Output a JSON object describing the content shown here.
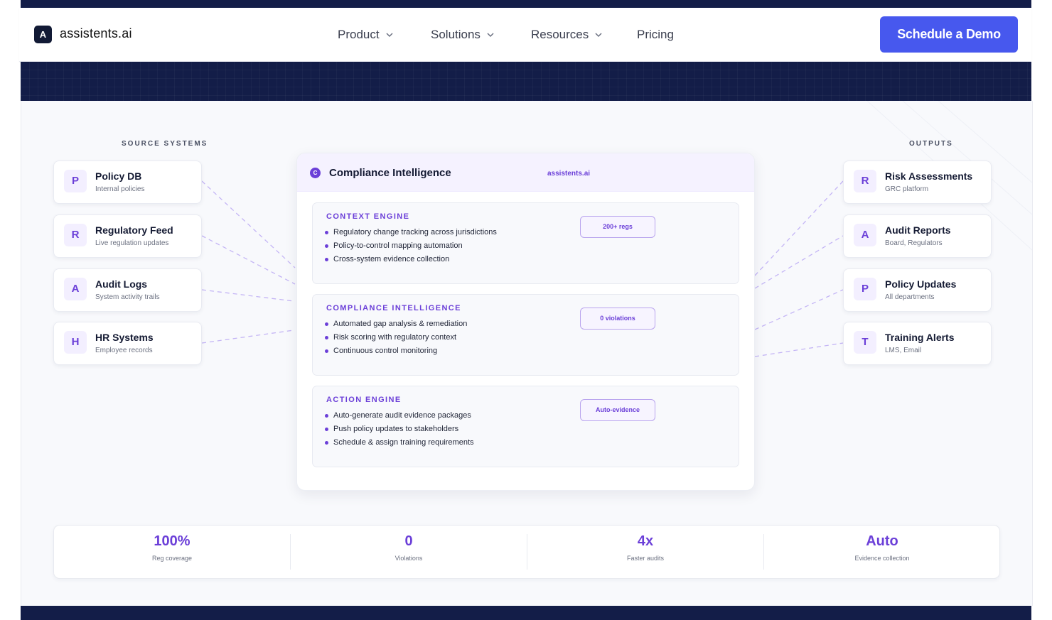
{
  "navbar": {
    "logo_letter": "A",
    "brand": "assistents.ai",
    "items": [
      {
        "label": "Product",
        "has_dropdown": true
      },
      {
        "label": "Solutions",
        "has_dropdown": true
      },
      {
        "label": "Resources",
        "has_dropdown": true
      },
      {
        "label": "Pricing",
        "has_dropdown": false
      }
    ],
    "cta_label": "Schedule a Demo"
  },
  "sources": {
    "title": "SOURCE SYSTEMS",
    "items": [
      {
        "letter": "P",
        "title": "Policy DB",
        "subtitle": "Internal policies"
      },
      {
        "letter": "R",
        "title": "Regulatory Feed",
        "subtitle": "Live regulation updates"
      },
      {
        "letter": "A",
        "title": "Audit Logs",
        "subtitle": "System activity trails"
      },
      {
        "letter": "H",
        "title": "HR Systems",
        "subtitle": "Employee records"
      }
    ]
  },
  "outputs": {
    "title": "OUTPUTS",
    "items": [
      {
        "letter": "R",
        "title": "Risk Assessments",
        "subtitle": "GRC platform"
      },
      {
        "letter": "A",
        "title": "Audit Reports",
        "subtitle": "Board, Regulators"
      },
      {
        "letter": "P",
        "title": "Policy Updates",
        "subtitle": "All departments"
      },
      {
        "letter": "T",
        "title": "Training Alerts",
        "subtitle": "LMS, Email"
      }
    ]
  },
  "center": {
    "icon_letter": "C",
    "title": "Compliance Intelligence",
    "brand": "assistents.ai",
    "engines": [
      {
        "title": "CONTEXT ENGINE",
        "pill": "200+ regs",
        "bullets": [
          "Regulatory change tracking across jurisdictions",
          "Policy-to-control mapping automation",
          "Cross-system evidence collection"
        ]
      },
      {
        "title": "COMPLIANCE INTELLIGENCE",
        "pill": "0 violations",
        "bullets": [
          "Automated gap analysis & remediation",
          "Risk scoring with regulatory context",
          "Continuous control monitoring"
        ]
      },
      {
        "title": "ACTION ENGINE",
        "pill": "Auto-evidence",
        "bullets": [
          "Auto-generate audit evidence packages",
          "Push policy updates to stakeholders",
          "Schedule & assign training requirements"
        ]
      }
    ]
  },
  "stats": [
    {
      "value": "100%",
      "label": "Reg coverage"
    },
    {
      "value": "0",
      "label": "Violations"
    },
    {
      "value": "4x",
      "label": "Faster audits"
    },
    {
      "value": "Auto",
      "label": "Evidence collection"
    }
  ],
  "colors": {
    "accent": "#6b3fd8",
    "cta": "#4758ee",
    "dark_band": "#131d48",
    "connector": "#c4b5f5"
  },
  "icons": {
    "dropdown": "chevron-down-icon"
  }
}
